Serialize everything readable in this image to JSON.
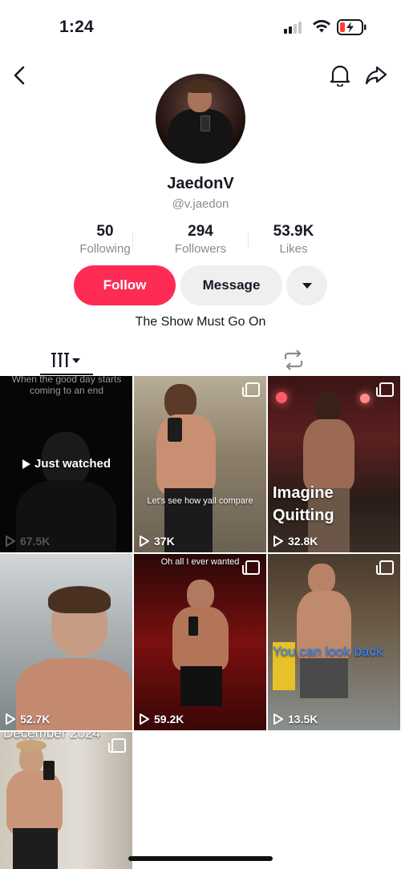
{
  "status_bar": {
    "time": "1:24"
  },
  "profile": {
    "display_name": "JaedonV",
    "handle": "@v.jaedon",
    "bio": "The Show Must Go On"
  },
  "stats": [
    {
      "value": "50",
      "label": "Following"
    },
    {
      "value": "294",
      "label": "Followers"
    },
    {
      "value": "53.9K",
      "label": "Likes"
    }
  ],
  "actions": {
    "follow_label": "Follow",
    "message_label": "Message"
  },
  "tabs": {
    "videos_icon": "grid-icon",
    "reposts_icon": "repost-icon"
  },
  "videos": [
    {
      "views": "67.5K",
      "caption_top": "When the good day starts coming to an end",
      "overlay": "Just watched"
    },
    {
      "views": "37K",
      "caption": "Let's see how yall compare",
      "multi": true
    },
    {
      "views": "32.8K",
      "caption": "Imagine Quitting",
      "multi": true
    },
    {
      "views": "52.7K"
    },
    {
      "views": "59.2K",
      "caption_top": "Oh all I ever wanted",
      "multi": true
    },
    {
      "views": "13.5K",
      "caption": "You can look back",
      "multi": true
    },
    {
      "caption_top": "December 2024",
      "multi": true
    }
  ],
  "colors": {
    "accent": "#fe2c55",
    "secondary_button": "#efefef",
    "muted_text": "#8a8b91"
  }
}
